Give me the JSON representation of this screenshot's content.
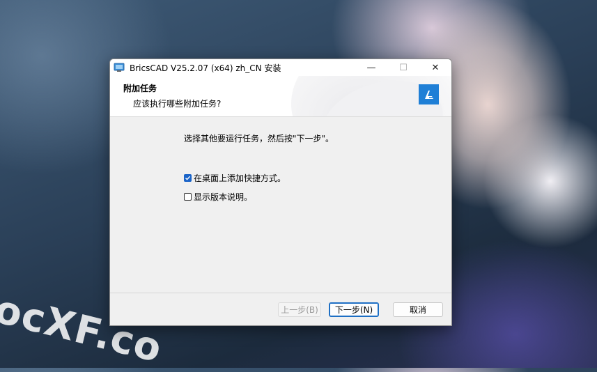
{
  "wallpaper": {
    "watermark_text": "ocXF.co"
  },
  "window": {
    "title": "BricsCAD V25.2.07 (x64) zh_CN 安装",
    "minimize_glyph": "—",
    "maximize_glyph": "☐",
    "close_glyph": "✕"
  },
  "header": {
    "title": "附加任务",
    "subtitle": "应该执行哪些附加任务?"
  },
  "content": {
    "instruction": "选择其他要运行任务，然后按\"下一步\"。",
    "tasks": [
      {
        "label": "在桌面上添加快捷方式。",
        "checked": true
      },
      {
        "label": "显示版本说明。",
        "checked": false
      }
    ]
  },
  "buttons": {
    "back": "上一步(B)",
    "next": "下一步(N)",
    "cancel": "取消"
  },
  "colors": {
    "accent": "#1b64c8",
    "brand": "#1f7fd6"
  },
  "icons": {
    "app": "installer-app-icon",
    "brand": "bricscad-logo-icon",
    "checkmark": "checkmark-icon"
  }
}
